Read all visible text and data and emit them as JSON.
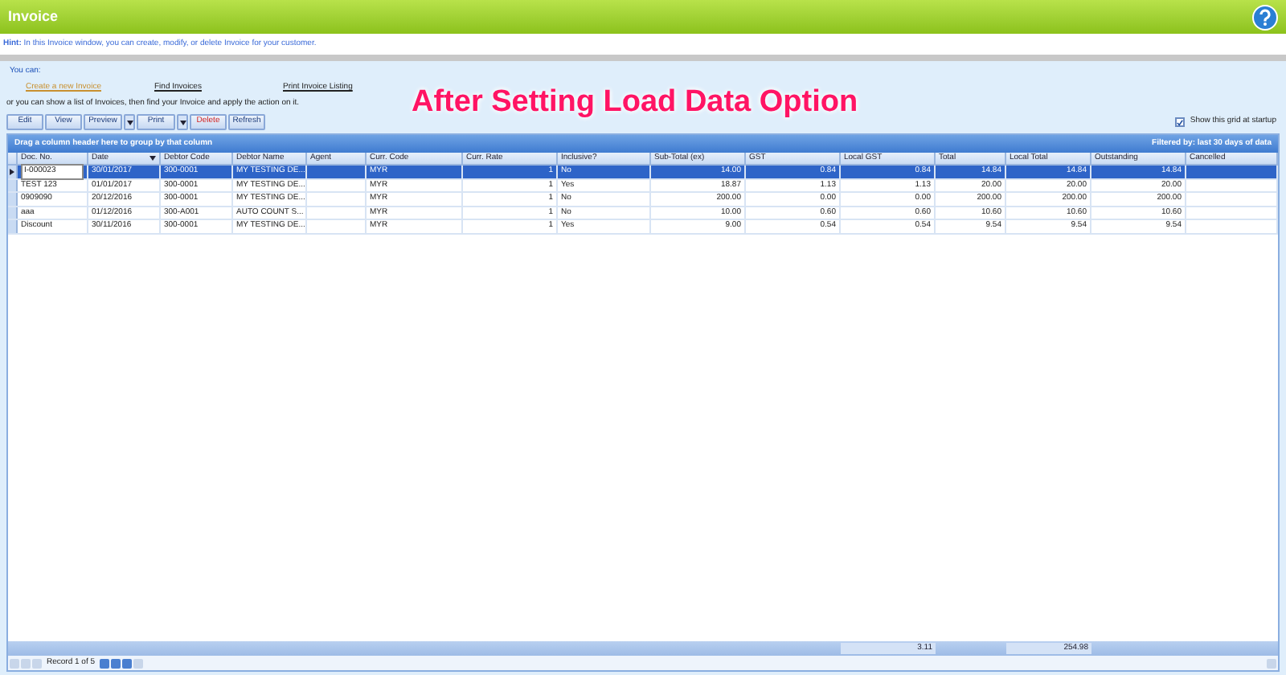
{
  "window": {
    "title": "Invoice"
  },
  "hint": {
    "label": "Hint:",
    "text": "In this Invoice window, you can create, modify, or delete Invoice for your customer."
  },
  "intro": "You can:",
  "links": [
    {
      "label": "Create a new Invoice",
      "selected": true
    },
    {
      "label": "Find Invoices",
      "selected": false
    },
    {
      "label": "Print Invoice Listing",
      "selected": false
    }
  ],
  "instruction": "or you can show a list of Invoices, then find your Invoice and apply the action on it.",
  "annotation": "After Setting Load Data Option",
  "toolbar": [
    {
      "label": "Edit",
      "kind": "plain"
    },
    {
      "label": "View",
      "kind": "plain"
    },
    {
      "label": "Preview",
      "kind": "split"
    },
    {
      "label": "Print",
      "kind": "split"
    },
    {
      "label": "Delete",
      "kind": "danger"
    },
    {
      "label": "Refresh",
      "kind": "plain"
    }
  ],
  "show_grid_at_startup": {
    "label": "Show this grid at startup",
    "checked": true
  },
  "group_panel": "Drag a column header here to group by that column",
  "filter_note": "Filtered by: last 30 days of data",
  "table": {
    "columns": [
      {
        "label": "Doc. No.",
        "kind": "text"
      },
      {
        "label": "Date",
        "kind": "text"
      },
      {
        "label": "Debtor Code",
        "kind": "text"
      },
      {
        "label": "Debtor Name",
        "kind": "text"
      },
      {
        "label": "Agent",
        "kind": "text"
      },
      {
        "label": "Curr. Code",
        "kind": "text"
      },
      {
        "label": "Curr. Rate",
        "kind": "number"
      },
      {
        "label": "Inclusive?",
        "kind": "text"
      },
      {
        "label": "Sub-Total (ex)",
        "kind": "number"
      },
      {
        "label": "GST",
        "kind": "number"
      },
      {
        "label": "Local GST",
        "kind": "number",
        "total": "3.11"
      },
      {
        "label": "Total",
        "kind": "number"
      },
      {
        "label": "Local Total",
        "kind": "number",
        "total": "254.98"
      },
      {
        "label": "Outstanding",
        "kind": "number"
      },
      {
        "label": "Cancelled",
        "kind": "text"
      }
    ],
    "rows": [
      {
        "selected": true,
        "cells": [
          "I-000023",
          "30/01/2017",
          "300-0001",
          "MY TESTING DE...",
          "",
          "MYR",
          "1",
          "No",
          "14.00",
          "0.84",
          "0.84",
          "14.84",
          "14.84",
          "14.84",
          ""
        ]
      },
      {
        "selected": false,
        "cells": [
          "TEST 123",
          "01/01/2017",
          "300-0001",
          "MY TESTING DE...",
          "",
          "MYR",
          "1",
          "Yes",
          "18.87",
          "1.13",
          "1.13",
          "20.00",
          "20.00",
          "20.00",
          ""
        ]
      },
      {
        "selected": false,
        "cells": [
          "0909090",
          "20/12/2016",
          "300-0001",
          "MY TESTING DE...",
          "",
          "MYR",
          "1",
          "No",
          "200.00",
          "0.00",
          "0.00",
          "200.00",
          "200.00",
          "200.00",
          ""
        ]
      },
      {
        "selected": false,
        "cells": [
          "aaa",
          "01/12/2016",
          "300-A001",
          "AUTO COUNT S...",
          "",
          "MYR",
          "1",
          "No",
          "10.00",
          "0.60",
          "0.60",
          "10.60",
          "10.60",
          "10.60",
          ""
        ]
      },
      {
        "selected": false,
        "cells": [
          "Discount",
          "30/11/2016",
          "300-0001",
          "MY TESTING DE...",
          "",
          "MYR",
          "1",
          "Yes",
          "9.00",
          "0.54",
          "0.54",
          "9.54",
          "9.54",
          "9.54",
          ""
        ]
      }
    ]
  },
  "navigator": {
    "record": "Record 1 of 5"
  }
}
